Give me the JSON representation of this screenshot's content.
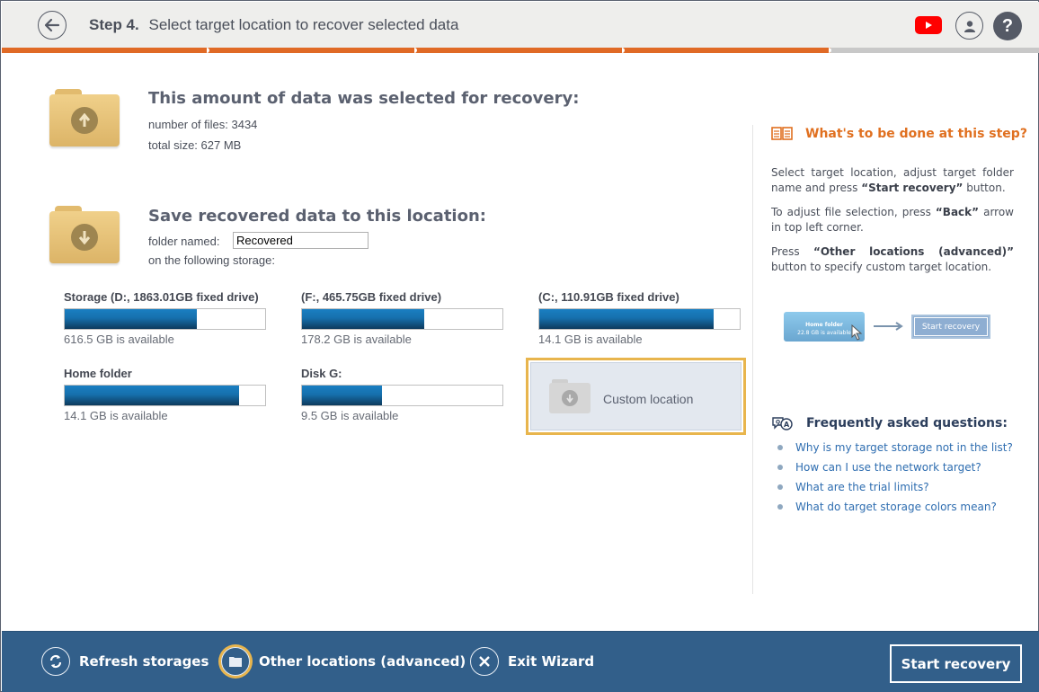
{
  "header": {
    "step_label": "Step 4.",
    "title": "Select target location to recover selected data",
    "help_glyph": "?"
  },
  "wizard_progress": {
    "steps_total": 5,
    "steps_completed": 4,
    "active_color": "#e06a26",
    "inactive_color": "#c8c8c8"
  },
  "selection": {
    "title": "This amount of data was selected for recovery:",
    "files_label": "number of files:",
    "files_value": "3434",
    "size_label": "total size:",
    "size_value": "627 MB",
    "files_line": "number of files: 3434",
    "size_line": "total size: 627 MB"
  },
  "target": {
    "title": "Save recovered data to this location:",
    "folder_label": "folder named:",
    "folder_value": "Recovered",
    "storage_label": "on the following storage:"
  },
  "storages": [
    {
      "name": "Storage (D:, 1863.01GB fixed drive)",
      "available": "616.5 GB is available",
      "used_fraction": 0.66
    },
    {
      "name": "(F:, 465.75GB fixed drive)",
      "available": "178.2 GB is available",
      "used_fraction": 0.61
    },
    {
      "name": "(C:, 110.91GB fixed drive)",
      "available": "14.1 GB is available",
      "used_fraction": 0.87
    },
    {
      "name": "Home folder",
      "available": "14.1 GB is available",
      "used_fraction": 0.87
    },
    {
      "name": "Disk G:",
      "available": "9.5 GB is available",
      "used_fraction": 0.4
    }
  ],
  "custom_location": {
    "label": "Custom location"
  },
  "help": {
    "title": "What's to be done at this step?",
    "p1_a": "Select target location, adjust target folder name and press ",
    "p1_b": "“Start recovery”",
    "p1_c": " button.",
    "p2_a": "To adjust file selection, press ",
    "p2_b": "“Back”",
    "p2_c": " arrow in top left corner.",
    "p3_a": "Press ",
    "p3_b": "“Other locations (advanced)”",
    "p3_c": " button to specify custom target location.",
    "demo_home_name": "Home folder",
    "demo_home_avail": "22.8 GB is available",
    "demo_start": "Start recovery"
  },
  "faq": {
    "title": "Frequently asked questions:",
    "items": [
      "Why is my target storage not in the list?",
      "How can I use the network target?",
      "What are the trial limits?",
      "What do target storage colors mean?"
    ]
  },
  "footer": {
    "refresh": "Refresh storages",
    "other": "Other locations (advanced)",
    "exit": "Exit Wizard",
    "start": "Start recovery"
  }
}
